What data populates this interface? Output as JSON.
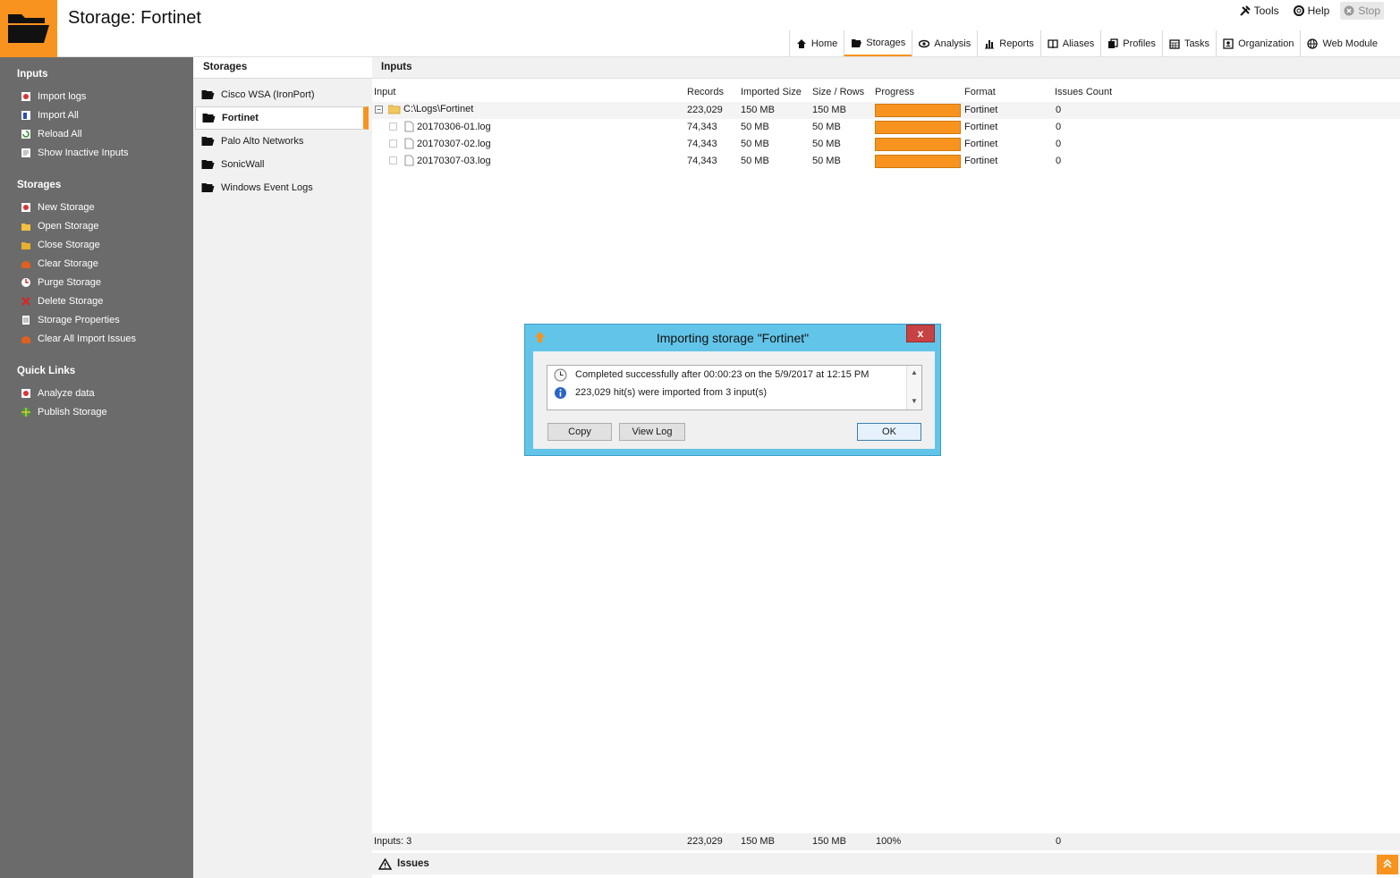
{
  "app": {
    "title": "Storage: Fortinet"
  },
  "toolbar": {
    "tools": "Tools",
    "help": "Help",
    "stop": "Stop"
  },
  "nav": [
    "Home",
    "Storages",
    "Analysis",
    "Reports",
    "Aliases",
    "Profiles",
    "Tasks",
    "Organization",
    "Web Module"
  ],
  "sidebar": {
    "inputs_title": "Inputs",
    "inputs": [
      "Import logs",
      "Import All",
      "Reload All",
      "Show Inactive Inputs"
    ],
    "storages_title": "Storages",
    "storages": [
      "New Storage",
      "Open Storage",
      "Close Storage",
      "Clear Storage",
      "Purge Storage",
      "Delete Storage",
      "Storage Properties",
      "Clear All Import Issues"
    ],
    "links_title": "Quick Links",
    "links": [
      "Analyze data",
      "Publish Storage"
    ]
  },
  "storages_panel": {
    "title": "Storages",
    "items": [
      "Cisco WSA (IronPort)",
      "Fortinet",
      "Palo Alto Networks",
      "SonicWall",
      "Windows Event Logs"
    ]
  },
  "inputs_panel": {
    "title": "Inputs",
    "columns": [
      "Input",
      "Records",
      "Imported Size",
      "Size / Rows",
      "Progress",
      "Format",
      "Issues Count"
    ],
    "rows": [
      {
        "name": "C:\\Logs\\Fortinet",
        "records": "223,029",
        "imported": "150 MB",
        "size": "150 MB",
        "progress": 1.0,
        "format": "Fortinet",
        "issues": "0"
      },
      {
        "name": "20170306-01.log",
        "records": "74,343",
        "imported": "50 MB",
        "size": "50 MB",
        "progress": 1.0,
        "format": "Fortinet",
        "issues": "0"
      },
      {
        "name": "20170307-02.log",
        "records": "74,343",
        "imported": "50 MB",
        "size": "50 MB",
        "progress": 1.0,
        "format": "Fortinet",
        "issues": "0"
      },
      {
        "name": "20170307-03.log",
        "records": "74,343",
        "imported": "50 MB",
        "size": "50 MB",
        "progress": 1.0,
        "format": "Fortinet",
        "issues": "0"
      }
    ],
    "footer": {
      "label": "Inputs: 3",
      "records": "223,029",
      "imported": "150 MB",
      "size": "150 MB",
      "progress": "100%",
      "issues": "0"
    },
    "issues_label": "Issues"
  },
  "dialog": {
    "title": "Importing storage \"Fortinet\"",
    "close": "x",
    "messages": [
      "Completed successfully after 00:00:23 on the 5/9/2017 at 12:15 PM",
      "223,029 hit(s) were imported from 3 input(s)"
    ],
    "buttons": {
      "copy": "Copy",
      "view_log": "View Log",
      "ok": "OK"
    }
  },
  "colors": {
    "accent": "#f7931e",
    "sidebar": "#6b6b6b",
    "dialog": "#62c4e8"
  }
}
